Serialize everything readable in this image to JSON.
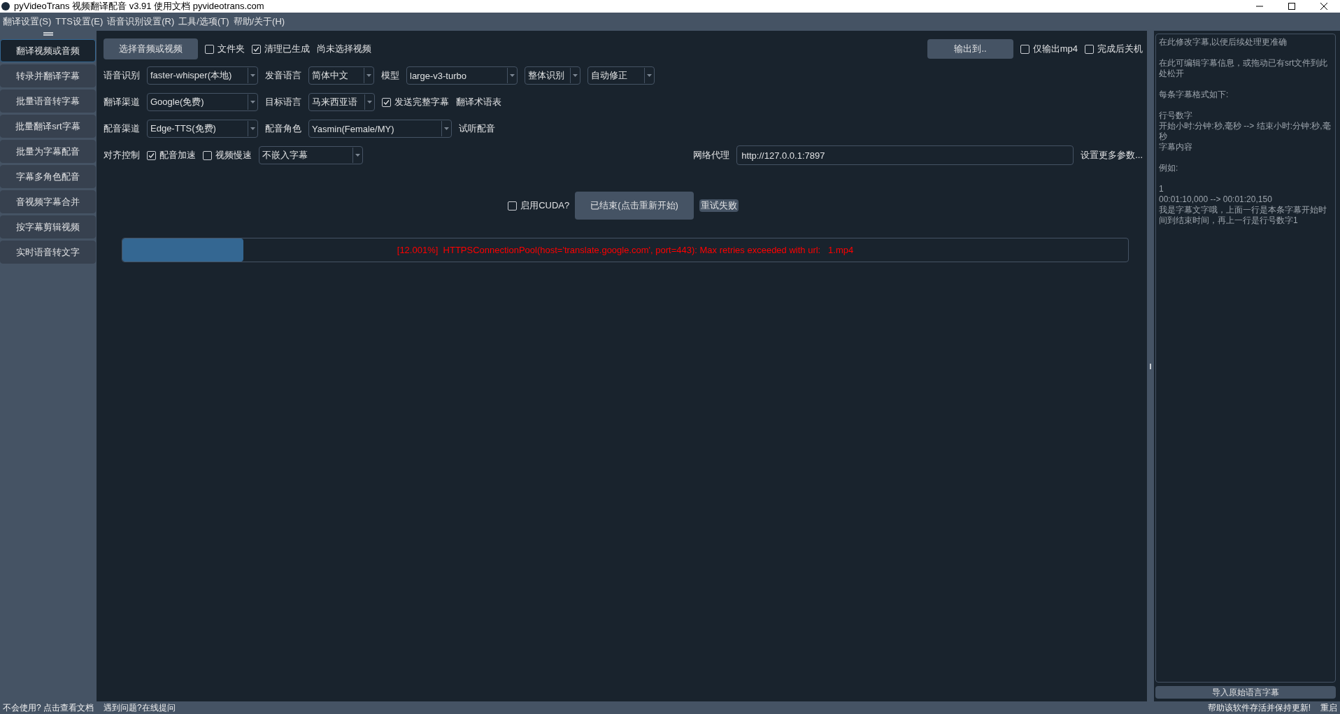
{
  "window": {
    "title": "pyVideoTrans 视频翻译配音 v3.91 使用文档 pyvideotrans.com"
  },
  "menu": [
    "翻译设置(S)",
    "TTS设置(E)",
    "语音识别设置(R)",
    "工具/选项(T)",
    "帮助/关于(H)"
  ],
  "sidebar": {
    "items": [
      {
        "label": "翻译视频或音频",
        "selected": true
      },
      {
        "label": "转录并翻译字幕",
        "selected": false
      },
      {
        "label": "批量语音转字幕",
        "selected": false
      },
      {
        "label": "批量翻译srt字幕",
        "selected": false
      },
      {
        "label": "批量为字幕配音",
        "selected": false
      },
      {
        "label": "字幕多角色配音",
        "selected": false
      },
      {
        "label": "音视频字幕合并",
        "selected": false
      },
      {
        "label": "按字幕剪辑视频",
        "selected": false
      },
      {
        "label": "实时语音转文字",
        "selected": false
      }
    ]
  },
  "toolbar": {
    "choose_button": "选择音频或视频",
    "checkboxes": [
      {
        "label": "文件夹",
        "checked": false
      },
      {
        "label": "清理已生成",
        "checked": true
      }
    ],
    "status": "尚未选择视频",
    "output_button": "输出到..",
    "right_checkboxes": [
      {
        "label": "仅输出mp4",
        "checked": false
      },
      {
        "label": "完成后关机",
        "checked": false
      }
    ]
  },
  "form_rows": [
    {
      "left": [
        {
          "kind": "label",
          "text": "语音识别"
        },
        {
          "kind": "select",
          "value": "faster-whisper(本地)"
        },
        {
          "kind": "label",
          "text": "发音语言"
        },
        {
          "kind": "select",
          "value": "简体中文"
        },
        {
          "kind": "label",
          "text": "模型"
        },
        {
          "kind": "select",
          "value": "large-v3-turbo"
        },
        {
          "kind": "select",
          "value": "整体识别"
        },
        {
          "kind": "select",
          "value": "自动修正"
        }
      ]
    },
    {
      "left": [
        {
          "kind": "label",
          "text": "翻译渠道"
        },
        {
          "kind": "select",
          "value": "Google(免费)"
        },
        {
          "kind": "label",
          "text": "目标语言"
        },
        {
          "kind": "select",
          "value": "马来西亚语"
        },
        {
          "kind": "checkbox",
          "text": "发送完整字幕",
          "checked": true
        },
        {
          "kind": "link",
          "text": "翻译术语表"
        }
      ]
    },
    {
      "left": [
        {
          "kind": "label",
          "text": "配音渠道"
        },
        {
          "kind": "select",
          "value": "Edge-TTS(免费)"
        },
        {
          "kind": "label",
          "text": "配音角色"
        },
        {
          "kind": "select",
          "value": "Yasmin(Female/MY)"
        },
        {
          "kind": "link",
          "text": "试听配音"
        }
      ]
    },
    {
      "left": [
        {
          "kind": "label",
          "text": "对齐控制"
        },
        {
          "kind": "checkbox",
          "text": "配音加速",
          "checked": true
        },
        {
          "kind": "checkbox",
          "text": "视频慢速",
          "checked": false
        },
        {
          "kind": "select",
          "value": "不嵌入字幕"
        }
      ],
      "right": [
        {
          "kind": "label",
          "text": "网络代理"
        },
        {
          "kind": "input",
          "value": "http://127.0.0.1:7897"
        },
        {
          "kind": "link",
          "text": "设置更多参数..."
        }
      ]
    }
  ],
  "actions": {
    "cuda": {
      "label": "启用CUDA?",
      "checked": false
    },
    "start_button": "已结束(点击重新开始)",
    "retry_button": "重试失败"
  },
  "progress": {
    "level": 0.12,
    "message": "[12.001%]  HTTPSConnectionPool(host='translate.google.com', port=443): Max retries exceeded with url:   1.mp4"
  },
  "subtitle_panel": {
    "placeholder_paragraphs": [
      [
        "在此修改字幕,以便后续处理更准确"
      ],
      [
        "在此可编辑字幕信息，或拖动已有srt文件到此处松开"
      ],
      [
        "每条字幕格式如下:"
      ],
      [
        "行号数字",
        "开始小时:分钟:秒,毫秒 --> 结束小时:分钟:秒,毫秒",
        "字幕内容"
      ],
      [
        "例如:"
      ],
      [
        "1",
        "00:01:10,000 --> 00:01:20,150",
        "我是字幕文字哦，上面一行是本条字幕开始时间到结束时间，再上一行是行号数字1"
      ]
    ],
    "import_button": "导入原始语言字幕"
  },
  "status_bar": {
    "left": [
      "不会使用? 点击查看文档",
      "遇到问题?在线提问"
    ],
    "right": [
      "帮助该软件存活并保持更新!",
      "重启"
    ]
  }
}
